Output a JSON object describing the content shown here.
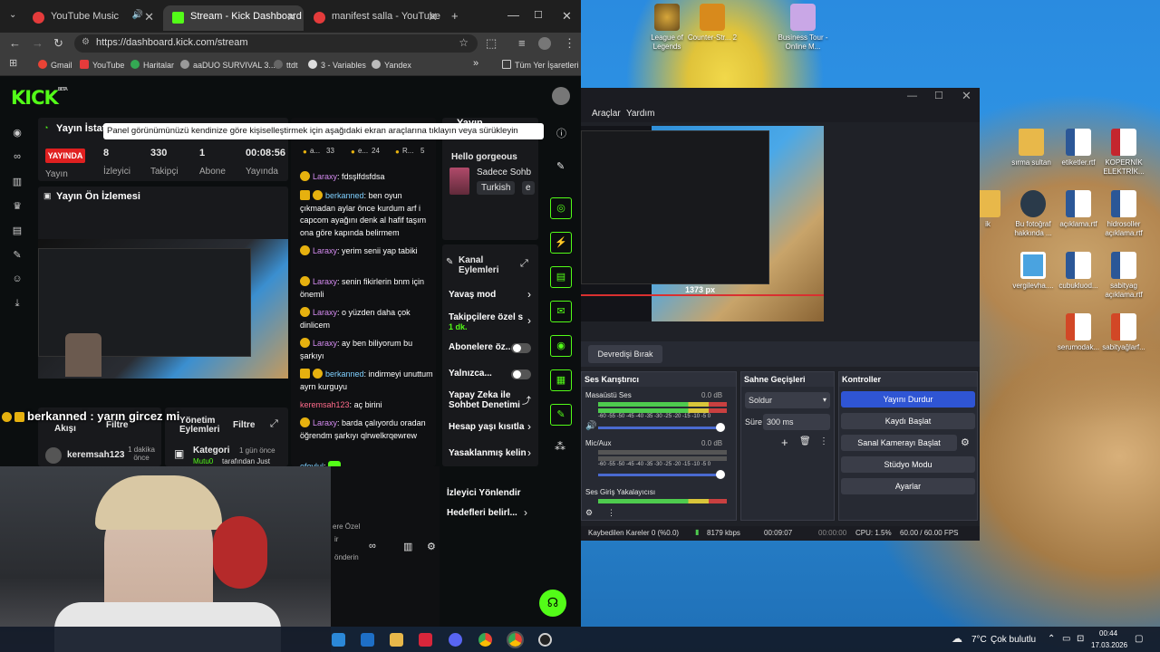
{
  "browser": {
    "tabs": [
      {
        "label": "YouTube Music",
        "icon": "youtube-music-icon",
        "color": "#e43b3b"
      },
      {
        "label": "Stream - Kick Dashboard",
        "icon": "kick-icon",
        "color": "#53fc18"
      },
      {
        "label": "manifest salla - YouTube",
        "icon": "youtube-icon",
        "color": "#e43b3b"
      }
    ],
    "url": "https://dashboard.kick.com/stream",
    "bookmarks": [
      "Gmail",
      "YouTube",
      "Haritalar",
      "aaDUO SURVIVAL 3...",
      "ttdt",
      "3 - Variables",
      "Yandex"
    ],
    "bookmarks_more": "»",
    "all_bookmarks": "Tüm Yer İşaretleri"
  },
  "kick": {
    "logo": "KICK",
    "logo_beta": "BETA",
    "tooltip": "Panel görünümünüzü kendinize göre kişiselleştirmek için aşağıdaki ekran araçlarına tıklayın veya sürükleyin",
    "stats": {
      "title": "Yayın İstatis",
      "live": "YAYINDA",
      "live_label": "Yayın",
      "viewers": "8",
      "viewers_label": "İzleyici",
      "followers": "330",
      "followers_label": "Takipçi",
      "subs": "1",
      "subs_label": "Abone",
      "duration": "00:08:56",
      "duration_label": "Yayında"
    },
    "preview_title": "Yayın Ön İzlemesi",
    "chat_header": {
      "a": "33",
      "b": "24",
      "c": "5",
      "a_label": "a...",
      "b_label": "e...",
      "c_label": "R..."
    },
    "chat": [
      {
        "user": "Laraxy",
        "msg": "fdsşlfdsfdsa"
      },
      {
        "user": "berkanned",
        "msg": "ben oyun çıkmadan aylar önce kurdum arf i capcom ayağını denk al hafif taşım ona göre kapında belirmem"
      },
      {
        "user": "Laraxy",
        "msg": "yerim senii yap tabiki"
      },
      {
        "user": "Laraxy",
        "msg": "senin fikirlerin bnm için önemli"
      },
      {
        "user": "Laraxy",
        "msg": "o yüzden daha çok dinlicem"
      },
      {
        "user": "Laraxy",
        "msg": "ay ben biliyorum bu şarkıyı"
      },
      {
        "user": "berkanned",
        "msg": "indirmeyi unuttum ayrn kurguyu"
      },
      {
        "user": "keremsah123",
        "msg": "aç birini"
      },
      {
        "user": "Laraxy",
        "msg": "barda çalıyordu oradan öğrendm şarkıyı qlrwelkrqewrew"
      },
      {
        "user": "efeylul",
        "msg": ""
      },
      {
        "user": "Laraxy",
        "msg": "ya sus be"
      },
      {
        "user": "berkanned",
        "msg": "yarın gircez mi"
      }
    ],
    "chat_footer": [
      "ere Özel",
      "ir",
      "önderin"
    ],
    "overlay_message": "berkanned : yarın gircez mi",
    "now_playing": {
      "title": "Yayın",
      "greeting": "Hello gorgeous",
      "artist": "Sadece Sohb",
      "tag": "Turkish",
      "tag2": "e"
    },
    "channel_actions": {
      "title": "Kanal Eylemleri",
      "items": [
        {
          "label": "Yavaş mod",
          "type": "chevron"
        },
        {
          "label": "Takipçilere özel s",
          "sub": "1 dk.",
          "type": "chevron"
        },
        {
          "label": "Abonelere öz...",
          "type": "toggle"
        },
        {
          "label": "Yalnızca...",
          "type": "toggle"
        },
        {
          "label": "Yapay Zeka ile Sohbet Denetimi",
          "type": "link"
        },
        {
          "label": "Hesap yaşı kısıtla",
          "type": "chevron"
        },
        {
          "label": "Yasaklanmış kelin",
          "type": "chevron"
        },
        {
          "label": "İzleyici Yönlendir",
          "type": "none"
        },
        {
          "label": "Hedefleri belirl...",
          "type": "chevron"
        }
      ]
    },
    "activity": {
      "title": "Akışı",
      "filter": "Filtre",
      "mod_title": "Yönetim Eylemleri",
      "mod_filter": "Filtre",
      "user": "keremsah123",
      "user_time": "1 dakika önce",
      "category": "Kategori",
      "category_time": "1 gün önce",
      "category_by": "Mutu0",
      "category_by_text": "tarafından Just"
    }
  },
  "obs": {
    "menu": [
      "Araçlar",
      "Yardım"
    ],
    "transition_btn": "Devredişi Bırak",
    "mixer": {
      "title": "Ses Karıştırıcı",
      "channels": [
        {
          "name": "Masaüstü Ses",
          "db": "0.0 dB"
        },
        {
          "name": "Mic/Aux",
          "db": "0.0 dB"
        },
        {
          "name": "Ses Giriş Yakalayıcısı",
          "db": ""
        }
      ],
      "ticks": "-60 -55 -50 -45 -40 -35 -30 -25 -20 -15 -10 -5 0"
    },
    "transitions": {
      "title": "Sahne Geçişleri",
      "selected": "Soldur",
      "duration_label": "Süre",
      "duration": "300 ms"
    },
    "controls": {
      "title": "Kontroller",
      "buttons": [
        "Yayını Durdur",
        "Kaydı Başlat",
        "Sanal Kamerayı Başlat",
        "Stüdyo Modu",
        "Ayarlar"
      ]
    },
    "status": {
      "dropped": "Kaybedilen Kareler 0 (%0.0)",
      "bitrate": "8179 kbps",
      "stream_time": "00:09:07",
      "rec_time": "00:00:00",
      "cpu": "CPU: 1.5%",
      "fps": "60.00 / 60.00 FPS"
    },
    "preview_label": "1373 px"
  },
  "desktop": {
    "icons": [
      {
        "label": "League of Legends",
        "type": "game"
      },
      {
        "label": "Counter-Str... 2",
        "type": "game"
      },
      {
        "label": "Business Tour - Online M...",
        "type": "game"
      },
      {
        "label": "sırma sultan",
        "type": "folder"
      },
      {
        "label": "etiketler.rtf",
        "type": "word"
      },
      {
        "label": "KOPERNİK ELEKTRİK...",
        "type": "pdf"
      },
      {
        "label": "ik",
        "type": "folder"
      },
      {
        "label": "Bu fotoğraf hakkında ...",
        "type": "info"
      },
      {
        "label": "açıklama.rtf",
        "type": "word"
      },
      {
        "label": "hidrosoller açıklama.rtf",
        "type": "word"
      },
      {
        "label": "vergilevha....",
        "type": "img"
      },
      {
        "label": "cubukluod...",
        "type": "word"
      },
      {
        "label": "sabityag açıklama.rtf",
        "type": "word"
      },
      {
        "label": "serumodak...",
        "type": "ppt"
      },
      {
        "label": "sabityağlarf...",
        "type": "ppt"
      }
    ]
  },
  "taskbar": {
    "weather": "7°C",
    "weather_text": "Çok bulutlu",
    "time": "00:44",
    "date": "17.03.2026"
  }
}
